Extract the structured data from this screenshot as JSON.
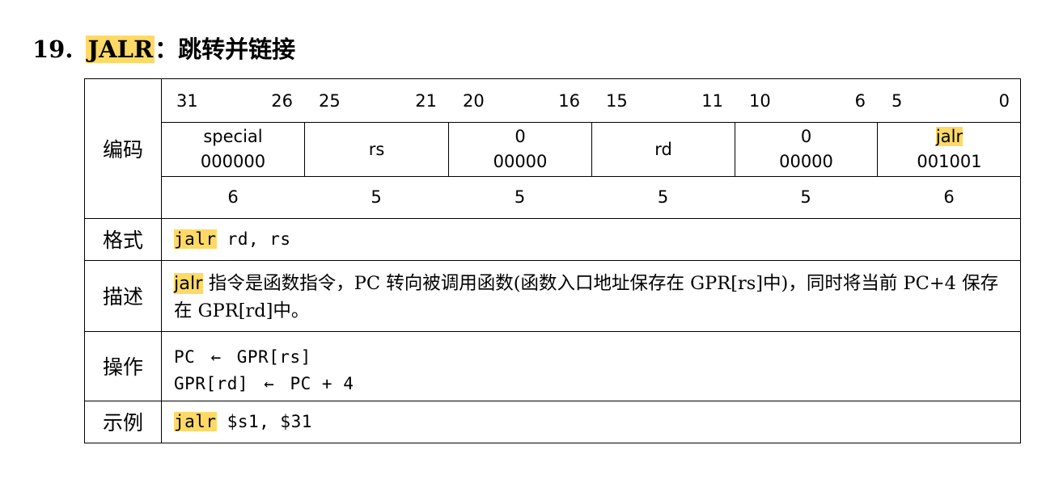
{
  "heading": {
    "number": "19.",
    "mnemonic": "JALR",
    "title": "：跳转并链接"
  },
  "labels": {
    "encoding": "编码",
    "format": "格式",
    "description": "描述",
    "operation": "操作",
    "example": "示例"
  },
  "encoding": {
    "bit_ranges": [
      {
        "hi": "31",
        "lo": "26"
      },
      {
        "hi": "25",
        "lo": "21"
      },
      {
        "hi": "20",
        "lo": "16"
      },
      {
        "hi": "15",
        "lo": "11"
      },
      {
        "hi": "10",
        "lo": "6"
      },
      {
        "hi": "5",
        "lo": "0"
      }
    ],
    "fields": [
      {
        "line1": "special",
        "line2": "000000"
      },
      {
        "line1": "rs",
        "line2": ""
      },
      {
        "line1": "0",
        "line2": "00000"
      },
      {
        "line1": "rd",
        "line2": ""
      },
      {
        "line1": "0",
        "line2": "00000"
      },
      {
        "line1": "jalr",
        "line2": "001001"
      }
    ],
    "widths": [
      "6",
      "5",
      "5",
      "5",
      "5",
      "6"
    ]
  },
  "format": {
    "mnemonic": "jalr",
    "operands": " rd, rs"
  },
  "description": {
    "mnemonic": "jalr",
    "text": " 指令是函数指令，PC 转向被调用函数(函数入口地址保存在 GPR[rs]中)，同时将当前 PC+4 保存在 GPR[rd]中。"
  },
  "operation": {
    "line1_left": "PC",
    "line1_arrow": "←",
    "line1_right": "GPR[rs]",
    "line2_left": "GPR[rd]",
    "line2_arrow": "←",
    "line2_right": "PC + 4"
  },
  "example": {
    "mnemonic": "jalr",
    "operands": " $s1, $31"
  }
}
